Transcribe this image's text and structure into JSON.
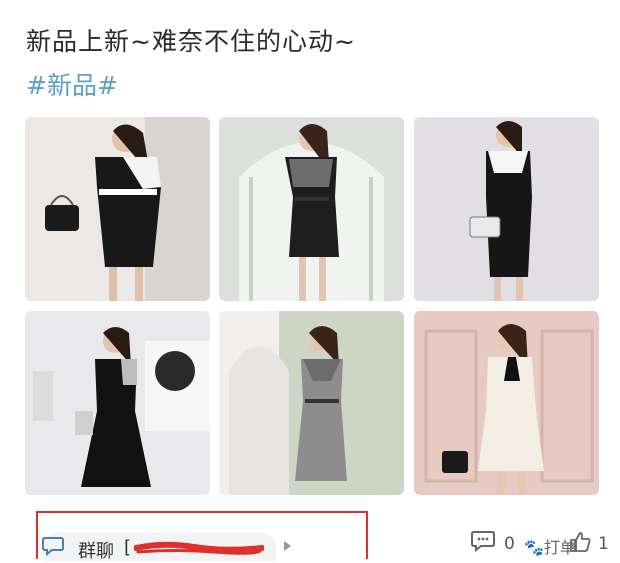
{
  "post": {
    "title": "新品上新~难奈不住的心动~",
    "hashtag": "#新品#"
  },
  "photos": [
    {
      "name": "dress-photo-1",
      "dress_color": "#1a1a1a",
      "bg": "#e9e6e3"
    },
    {
      "name": "dress-photo-2",
      "dress_color": "#1c1c1c",
      "bg": "#d9dcd8"
    },
    {
      "name": "dress-photo-3",
      "dress_color": "#141414",
      "bg": "#dedbe0"
    },
    {
      "name": "dress-photo-4",
      "dress_color": "#111111",
      "bg": "#e7e7ea"
    },
    {
      "name": "dress-photo-5",
      "dress_color": "#8a8a8a",
      "bg": "#cfd6c6"
    },
    {
      "name": "dress-photo-6",
      "dress_color": "#f2ede4",
      "bg": "#e6c9c0"
    }
  ],
  "group": {
    "label": "群聊",
    "name": "[",
    "icon": "chat-bubble-icon"
  },
  "actions": {
    "comment_count": "0",
    "like_count": "1",
    "watermark": "🐾打单"
  },
  "colors": {
    "hashtag": "#5fa0c8",
    "highlight_border": "#e0302c"
  }
}
